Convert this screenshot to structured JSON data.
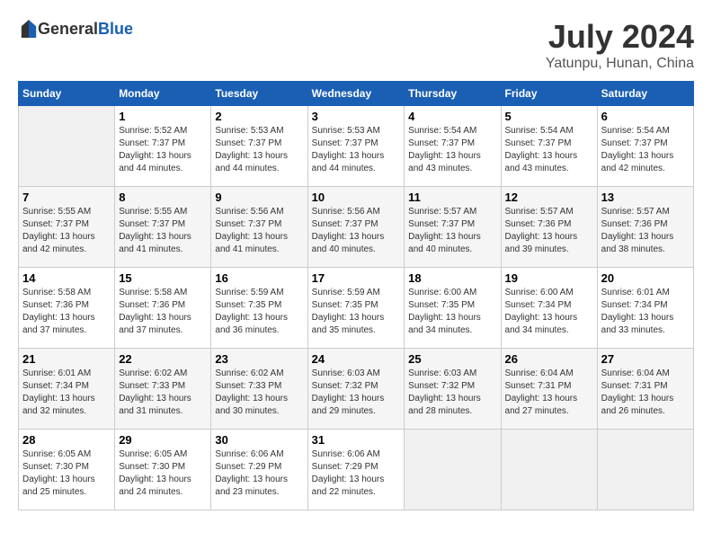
{
  "header": {
    "logo_general": "General",
    "logo_blue": "Blue",
    "month_year": "July 2024",
    "location": "Yatunpu, Hunan, China"
  },
  "weekdays": [
    "Sunday",
    "Monday",
    "Tuesday",
    "Wednesday",
    "Thursday",
    "Friday",
    "Saturday"
  ],
  "weeks": [
    [
      {
        "day": "",
        "sunrise": "",
        "sunset": "",
        "daylight": ""
      },
      {
        "day": "1",
        "sunrise": "Sunrise: 5:52 AM",
        "sunset": "Sunset: 7:37 PM",
        "daylight": "Daylight: 13 hours and 44 minutes."
      },
      {
        "day": "2",
        "sunrise": "Sunrise: 5:53 AM",
        "sunset": "Sunset: 7:37 PM",
        "daylight": "Daylight: 13 hours and 44 minutes."
      },
      {
        "day": "3",
        "sunrise": "Sunrise: 5:53 AM",
        "sunset": "Sunset: 7:37 PM",
        "daylight": "Daylight: 13 hours and 44 minutes."
      },
      {
        "day": "4",
        "sunrise": "Sunrise: 5:54 AM",
        "sunset": "Sunset: 7:37 PM",
        "daylight": "Daylight: 13 hours and 43 minutes."
      },
      {
        "day": "5",
        "sunrise": "Sunrise: 5:54 AM",
        "sunset": "Sunset: 7:37 PM",
        "daylight": "Daylight: 13 hours and 43 minutes."
      },
      {
        "day": "6",
        "sunrise": "Sunrise: 5:54 AM",
        "sunset": "Sunset: 7:37 PM",
        "daylight": "Daylight: 13 hours and 42 minutes."
      }
    ],
    [
      {
        "day": "7",
        "sunrise": "Sunrise: 5:55 AM",
        "sunset": "Sunset: 7:37 PM",
        "daylight": "Daylight: 13 hours and 42 minutes."
      },
      {
        "day": "8",
        "sunrise": "Sunrise: 5:55 AM",
        "sunset": "Sunset: 7:37 PM",
        "daylight": "Daylight: 13 hours and 41 minutes."
      },
      {
        "day": "9",
        "sunrise": "Sunrise: 5:56 AM",
        "sunset": "Sunset: 7:37 PM",
        "daylight": "Daylight: 13 hours and 41 minutes."
      },
      {
        "day": "10",
        "sunrise": "Sunrise: 5:56 AM",
        "sunset": "Sunset: 7:37 PM",
        "daylight": "Daylight: 13 hours and 40 minutes."
      },
      {
        "day": "11",
        "sunrise": "Sunrise: 5:57 AM",
        "sunset": "Sunset: 7:37 PM",
        "daylight": "Daylight: 13 hours and 40 minutes."
      },
      {
        "day": "12",
        "sunrise": "Sunrise: 5:57 AM",
        "sunset": "Sunset: 7:36 PM",
        "daylight": "Daylight: 13 hours and 39 minutes."
      },
      {
        "day": "13",
        "sunrise": "Sunrise: 5:57 AM",
        "sunset": "Sunset: 7:36 PM",
        "daylight": "Daylight: 13 hours and 38 minutes."
      }
    ],
    [
      {
        "day": "14",
        "sunrise": "Sunrise: 5:58 AM",
        "sunset": "Sunset: 7:36 PM",
        "daylight": "Daylight: 13 hours and 37 minutes."
      },
      {
        "day": "15",
        "sunrise": "Sunrise: 5:58 AM",
        "sunset": "Sunset: 7:36 PM",
        "daylight": "Daylight: 13 hours and 37 minutes."
      },
      {
        "day": "16",
        "sunrise": "Sunrise: 5:59 AM",
        "sunset": "Sunset: 7:35 PM",
        "daylight": "Daylight: 13 hours and 36 minutes."
      },
      {
        "day": "17",
        "sunrise": "Sunrise: 5:59 AM",
        "sunset": "Sunset: 7:35 PM",
        "daylight": "Daylight: 13 hours and 35 minutes."
      },
      {
        "day": "18",
        "sunrise": "Sunrise: 6:00 AM",
        "sunset": "Sunset: 7:35 PM",
        "daylight": "Daylight: 13 hours and 34 minutes."
      },
      {
        "day": "19",
        "sunrise": "Sunrise: 6:00 AM",
        "sunset": "Sunset: 7:34 PM",
        "daylight": "Daylight: 13 hours and 34 minutes."
      },
      {
        "day": "20",
        "sunrise": "Sunrise: 6:01 AM",
        "sunset": "Sunset: 7:34 PM",
        "daylight": "Daylight: 13 hours and 33 minutes."
      }
    ],
    [
      {
        "day": "21",
        "sunrise": "Sunrise: 6:01 AM",
        "sunset": "Sunset: 7:34 PM",
        "daylight": "Daylight: 13 hours and 32 minutes."
      },
      {
        "day": "22",
        "sunrise": "Sunrise: 6:02 AM",
        "sunset": "Sunset: 7:33 PM",
        "daylight": "Daylight: 13 hours and 31 minutes."
      },
      {
        "day": "23",
        "sunrise": "Sunrise: 6:02 AM",
        "sunset": "Sunset: 7:33 PM",
        "daylight": "Daylight: 13 hours and 30 minutes."
      },
      {
        "day": "24",
        "sunrise": "Sunrise: 6:03 AM",
        "sunset": "Sunset: 7:32 PM",
        "daylight": "Daylight: 13 hours and 29 minutes."
      },
      {
        "day": "25",
        "sunrise": "Sunrise: 6:03 AM",
        "sunset": "Sunset: 7:32 PM",
        "daylight": "Daylight: 13 hours and 28 minutes."
      },
      {
        "day": "26",
        "sunrise": "Sunrise: 6:04 AM",
        "sunset": "Sunset: 7:31 PM",
        "daylight": "Daylight: 13 hours and 27 minutes."
      },
      {
        "day": "27",
        "sunrise": "Sunrise: 6:04 AM",
        "sunset": "Sunset: 7:31 PM",
        "daylight": "Daylight: 13 hours and 26 minutes."
      }
    ],
    [
      {
        "day": "28",
        "sunrise": "Sunrise: 6:05 AM",
        "sunset": "Sunset: 7:30 PM",
        "daylight": "Daylight: 13 hours and 25 minutes."
      },
      {
        "day": "29",
        "sunrise": "Sunrise: 6:05 AM",
        "sunset": "Sunset: 7:30 PM",
        "daylight": "Daylight: 13 hours and 24 minutes."
      },
      {
        "day": "30",
        "sunrise": "Sunrise: 6:06 AM",
        "sunset": "Sunset: 7:29 PM",
        "daylight": "Daylight: 13 hours and 23 minutes."
      },
      {
        "day": "31",
        "sunrise": "Sunrise: 6:06 AM",
        "sunset": "Sunset: 7:29 PM",
        "daylight": "Daylight: 13 hours and 22 minutes."
      },
      {
        "day": "",
        "sunrise": "",
        "sunset": "",
        "daylight": ""
      },
      {
        "day": "",
        "sunrise": "",
        "sunset": "",
        "daylight": ""
      },
      {
        "day": "",
        "sunrise": "",
        "sunset": "",
        "daylight": ""
      }
    ]
  ]
}
